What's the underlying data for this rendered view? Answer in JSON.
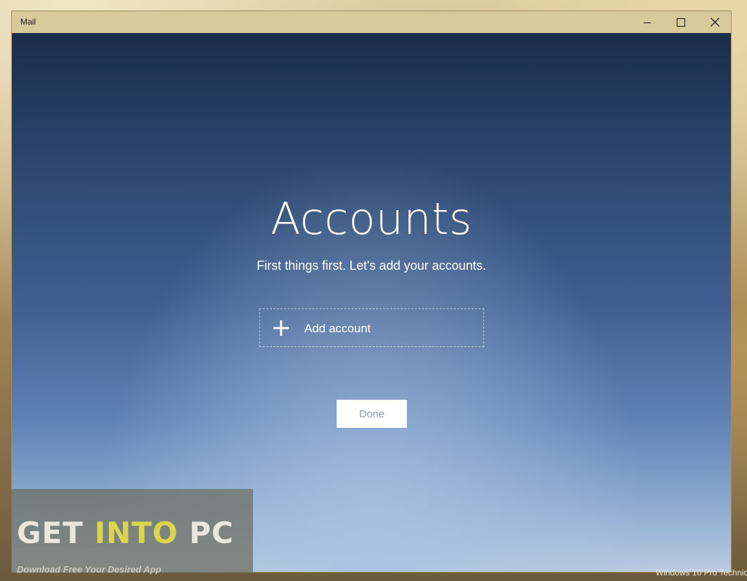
{
  "window": {
    "title": "Mail"
  },
  "accounts": {
    "heading": "Accounts",
    "subtitle": "First things first. Let's add your accounts.",
    "add_account_label": "Add account",
    "done_label": "Done"
  },
  "watermark": {
    "logo_part1": "GET ",
    "logo_part2": "INTO",
    "logo_part3": " PC",
    "tagline": "Download Free Your Desired App"
  },
  "desktop": {
    "corner_text": "Windows 10 Pro Technic"
  },
  "colors": {
    "titlebar": "#d9ca9c",
    "content_top": "#1a2d4a",
    "content_bottom": "#b9cce2",
    "done_text": "#8a9aac",
    "watermark_accent": "#d9d64a"
  },
  "icons": {
    "minimize": "minimize-icon",
    "maximize": "maximize-icon",
    "close": "close-icon",
    "add": "plus-icon"
  }
}
